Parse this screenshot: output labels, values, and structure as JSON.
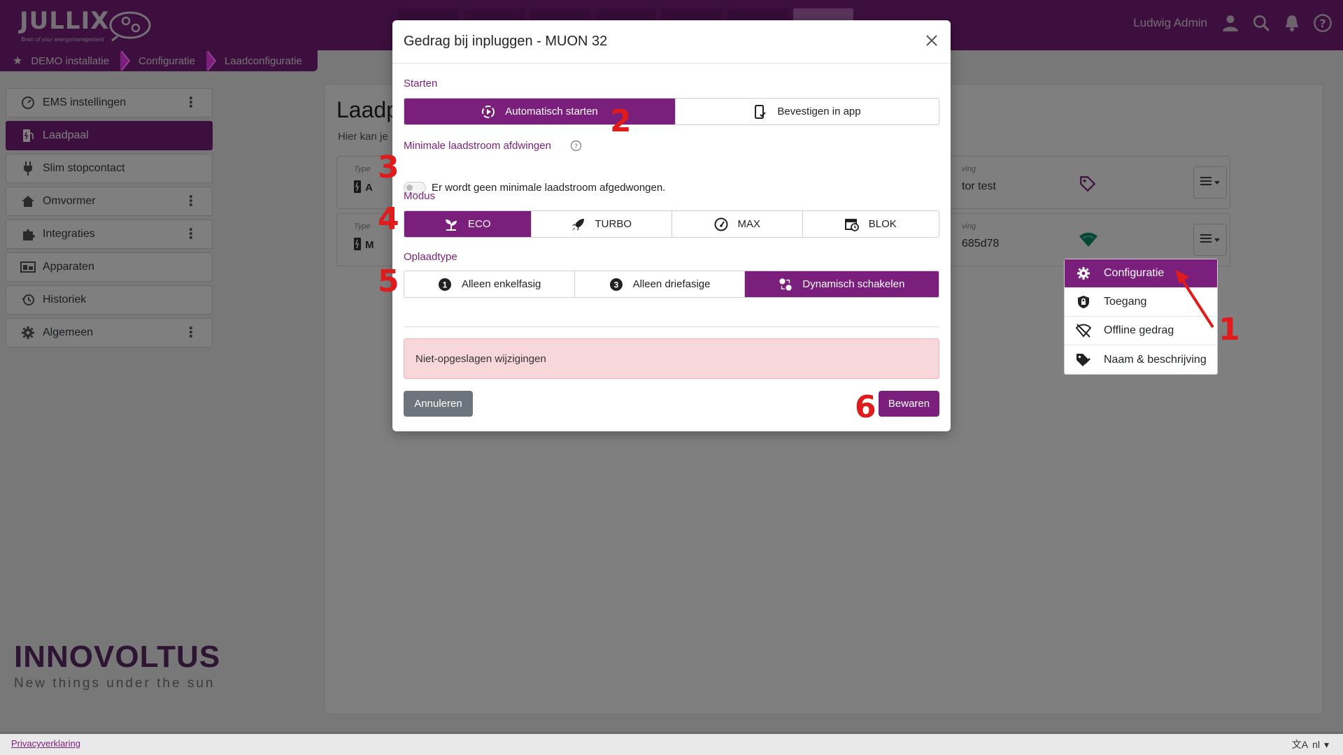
{
  "topbar": {
    "logo_text": "JULLIX",
    "logo_tagline": "Brain of your energymanagement",
    "user_name": "Ludwig Admin",
    "nav_count": 7
  },
  "breadcrumb": [
    "DEMO installatie",
    "Configuratie",
    "Laadconfiguratie"
  ],
  "sidebar": {
    "items": [
      {
        "label": "EMS instellingen",
        "icon": "dashboard-icon",
        "menu": true
      },
      {
        "label": "Laadpaal",
        "icon": "ev-charger-icon",
        "active": true
      },
      {
        "label": "Slim stopcontact",
        "icon": "plug-icon"
      },
      {
        "label": "Omvormer",
        "icon": "house-icon",
        "menu": true
      },
      {
        "label": "Integraties",
        "icon": "puzzle-icon",
        "menu": true
      },
      {
        "label": "Apparaten",
        "icon": "devices-icon"
      },
      {
        "label": "Historiek",
        "icon": "history-icon"
      },
      {
        "label": "Algemeen",
        "icon": "gear-icon",
        "menu": true
      }
    ]
  },
  "brand_footer": {
    "name": "INNOVOLTUS",
    "tagline": "New things under the sun"
  },
  "main": {
    "title": "Laadp",
    "subtitle": "Hier kan je",
    "cards": [
      {
        "type_label": "Type",
        "type_val": "A",
        "desc_label": "ving",
        "desc_val": "tor test",
        "right_icon": "tag-icon"
      },
      {
        "type_label": "Type",
        "type_val": "M",
        "desc_label": "ving",
        "desc_val": "685d78",
        "right_icon": "wifi-icon"
      }
    ]
  },
  "dropdown": {
    "items": [
      {
        "label": "Configuratie",
        "icon": "gear-icon",
        "active": true
      },
      {
        "label": "Toegang",
        "icon": "lock-icon"
      },
      {
        "label": "Offline gedrag",
        "icon": "wifi-off-icon"
      },
      {
        "label": "Naam & beschrijving",
        "icon": "tag-edit-icon"
      }
    ]
  },
  "modal": {
    "title": "Gedrag bij inpluggen - MUON 32",
    "starten": {
      "label": "Starten",
      "options": [
        {
          "label": "Automatisch starten",
          "selected": true
        },
        {
          "label": "Bevestigen in app",
          "selected": false
        }
      ]
    },
    "min_current": {
      "label": "Minimale laadstroom afdwingen",
      "enabled": false,
      "status_text": "Er wordt geen minimale laadstroom afgedwongen."
    },
    "modus": {
      "label": "Modus",
      "options": [
        {
          "label": "ECO",
          "selected": true
        },
        {
          "label": "TURBO",
          "selected": false
        },
        {
          "label": "MAX",
          "selected": false
        },
        {
          "label": "BLOK",
          "selected": false
        }
      ]
    },
    "oplaadtype": {
      "label": "Oplaadtype",
      "options": [
        {
          "label": "Alleen enkelfasig",
          "badge": "1",
          "selected": false
        },
        {
          "label": "Alleen driefasige",
          "badge": "3",
          "selected": false
        },
        {
          "label": "Dynamisch schakelen",
          "selected": true
        }
      ]
    },
    "alert_text": "Niet-opgeslagen wijzigingen",
    "cancel_label": "Annuleren",
    "save_label": "Bewaren"
  },
  "annotations": [
    "1",
    "2",
    "3",
    "4",
    "5",
    "6"
  ],
  "footer": {
    "privacy_label": "Privacyverklaring",
    "language": "nl"
  },
  "colors": {
    "primary": "#7a1f7c",
    "annotation": "#e01b1b",
    "alert_bg": "#f8d7da",
    "wifi": "#0d8f6f"
  }
}
